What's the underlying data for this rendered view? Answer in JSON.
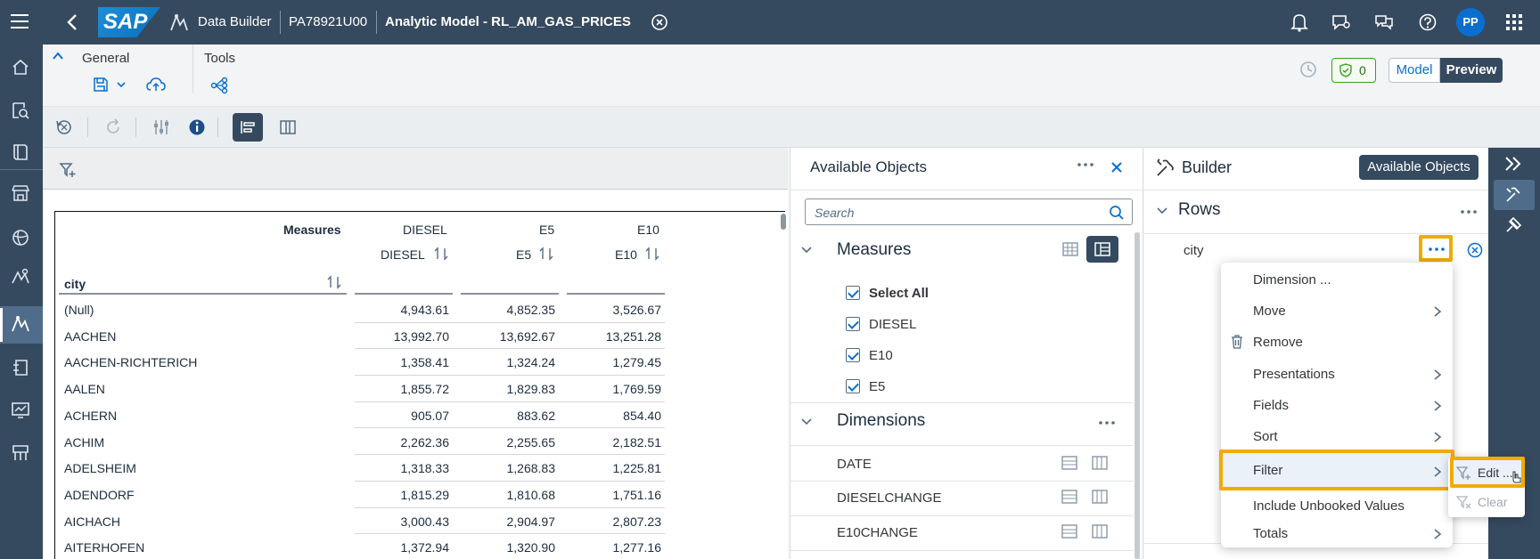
{
  "shell": {
    "product": "SAP",
    "breadcrumb1": "Data Builder",
    "space": "PA78921U00",
    "title": "Analytic Model - RL_AM_GAS_PRICES",
    "avatar": "PP"
  },
  "header": {
    "general_label": "General",
    "tools_label": "Tools",
    "badge_count": "0",
    "model_label": "Model",
    "preview_label": "Preview"
  },
  "table": {
    "measures_label": "Measures",
    "city_label": "city",
    "columns": [
      {
        "group": "DIESEL",
        "name": "DIESEL"
      },
      {
        "group": "E5",
        "name": "E5"
      },
      {
        "group": "E10",
        "name": "E10"
      }
    ],
    "rows": [
      {
        "city": "(Null)",
        "diesel": "4,943.61",
        "e5": "4,852.35",
        "e10": "3,526.67"
      },
      {
        "city": "AACHEN",
        "diesel": "13,992.70",
        "e5": "13,692.67",
        "e10": "13,251.28"
      },
      {
        "city": "AACHEN-RICHTERICH",
        "diesel": "1,358.41",
        "e5": "1,324.24",
        "e10": "1,279.45"
      },
      {
        "city": "AALEN",
        "diesel": "1,855.72",
        "e5": "1,829.83",
        "e10": "1,769.59"
      },
      {
        "city": "ACHERN",
        "diesel": "905.07",
        "e5": "883.62",
        "e10": "854.40"
      },
      {
        "city": "ACHIM",
        "diesel": "2,262.36",
        "e5": "2,255.65",
        "e10": "2,182.51"
      },
      {
        "city": "ADELSHEIM",
        "diesel": "1,318.33",
        "e5": "1,268.83",
        "e10": "1,225.81"
      },
      {
        "city": "ADENDORF",
        "diesel": "1,815.29",
        "e5": "1,810.68",
        "e10": "1,751.16"
      },
      {
        "city": "AICHACH",
        "diesel": "3,000.43",
        "e5": "2,904.97",
        "e10": "2,807.23"
      },
      {
        "city": "AITERHOFEN",
        "diesel": "1,372.94",
        "e5": "1,320.90",
        "e10": "1,277.16"
      }
    ]
  },
  "available": {
    "title": "Available Objects",
    "search_placeholder": "Search",
    "measures_title": "Measures",
    "measures": [
      "Select All",
      "DIESEL",
      "E10",
      "E5"
    ],
    "dimensions_title": "Dimensions",
    "dimensions": [
      "DATE",
      "DIESELCHANGE",
      "E10CHANGE"
    ]
  },
  "builder": {
    "title": "Builder",
    "available_button": "Available Objects",
    "rows_title": "Rows",
    "row_item": "city"
  },
  "menu": {
    "items": [
      "Dimension ...",
      "Move",
      "Remove",
      "Presentations",
      "Fields",
      "Sort",
      "Filter",
      "Include Unbooked Values",
      "Totals"
    ],
    "sub_edit": "Edit ...",
    "sub_clear": "Clear"
  },
  "colors": {
    "shell": "#354a5f",
    "highlight": "#f0ab00",
    "accent": "#0a6ed1"
  }
}
